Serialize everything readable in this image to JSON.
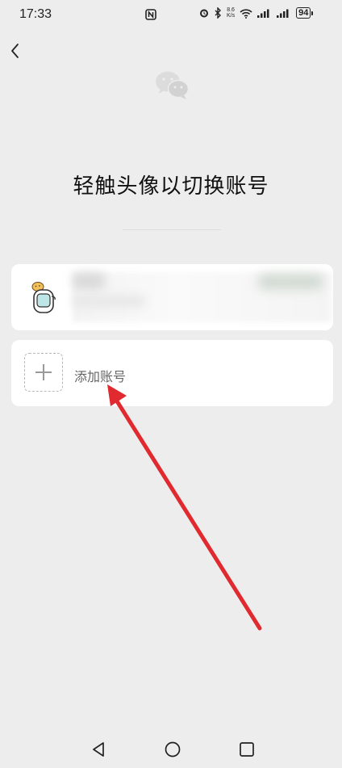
{
  "status_bar": {
    "time": "17:33",
    "net_speed_value": "8.6",
    "net_speed_unit": "K/s",
    "battery": "94"
  },
  "page": {
    "title": "轻触头像以切换账号"
  },
  "add_account": {
    "label": "添加账号"
  },
  "icons": {
    "back": "chevron-left-icon",
    "logo": "wechat-logo-icon",
    "nav_back": "triangle-back-icon",
    "nav_home": "circle-home-icon",
    "nav_recent": "square-recent-icon"
  },
  "colors": {
    "background": "#ededed",
    "card": "#ffffff",
    "annotation": "#e02a2f"
  }
}
